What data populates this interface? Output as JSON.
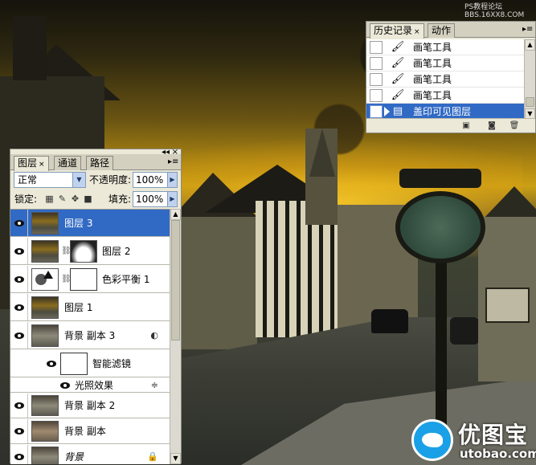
{
  "watermark_top": [
    "PS教程论坛",
    "BBS.16XX8.COM"
  ],
  "logo": {
    "name": "优图宝",
    "sub": "utobao.com"
  },
  "history": {
    "tabs": [
      {
        "label": "历史记录",
        "close": "×"
      },
      {
        "label": "动作"
      }
    ],
    "items": [
      {
        "label": "画笔工具",
        "icon": "brush-icon",
        "selected": false
      },
      {
        "label": "画笔工具",
        "icon": "brush-icon",
        "selected": false
      },
      {
        "label": "画笔工具",
        "icon": "brush-icon",
        "selected": false
      },
      {
        "label": "画笔工具",
        "icon": "brush-icon",
        "selected": false
      },
      {
        "label": "盖印可见图层",
        "icon": "stamp-layer-icon",
        "selected": true
      }
    ],
    "footer_icons": [
      "new-document-from-state-icon",
      "snapshot-icon",
      "trash-icon"
    ]
  },
  "layers": {
    "tabs": [
      {
        "label": "图层",
        "close": "×"
      },
      {
        "label": "通道"
      },
      {
        "label": "路径"
      }
    ],
    "blend_mode": "正常",
    "opacity_label": "不透明度:",
    "opacity_value": "100%",
    "lock_label": "锁定:",
    "fill_label": "填充:",
    "fill_value": "100%",
    "items": [
      {
        "name": "图层 3",
        "selected": true,
        "thumb": "photo"
      },
      {
        "name": "图层 2",
        "selected": false,
        "thumb": "photo",
        "mask": true
      },
      {
        "name": "色彩平衡 1",
        "selected": false,
        "thumb": "adjustment",
        "mask": true
      },
      {
        "name": "图层 1",
        "selected": false,
        "thumb": "photo"
      },
      {
        "name": "背景 副本 3",
        "selected": false,
        "thumb": "smart-object"
      },
      {
        "name": "智能滤镜",
        "selected": false,
        "thumb": "filter-mask"
      },
      {
        "name": "光照效果",
        "selected": false
      },
      {
        "name": "背景 副本 2",
        "selected": false,
        "thumb": "photo"
      },
      {
        "name": "背景 副本",
        "selected": false,
        "thumb": "photo"
      },
      {
        "name": "背景",
        "selected": false,
        "thumb": "photo",
        "locked": true
      }
    ]
  }
}
